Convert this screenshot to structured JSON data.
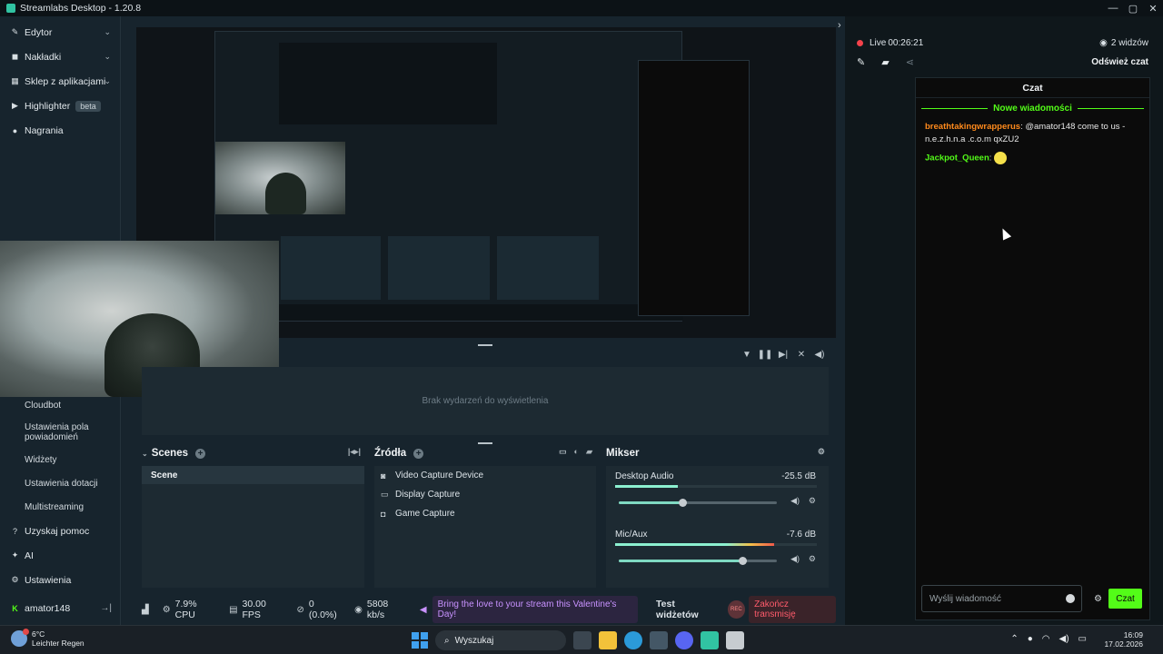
{
  "titlebar": {
    "title": "Streamlabs Desktop - 1.20.8",
    "controls": [
      "—",
      "▢",
      "✕"
    ]
  },
  "sidebar": {
    "items": [
      {
        "label": "Edytor",
        "icon": "pencil-icon",
        "chevron": "⌄"
      },
      {
        "label": "Nakładki",
        "icon": "overlay-icon",
        "chevron": "⌄"
      },
      {
        "label": "Sklep z aplikacjami",
        "icon": "store-icon",
        "chevron": "⌄"
      },
      {
        "label": "Highlighter",
        "icon": "highlighter-icon",
        "badge": "beta"
      },
      {
        "label": "Nagrania",
        "icon": "record-icon"
      }
    ],
    "subitems": [
      "Cloudbot",
      "Ustawienia pola powiadomień",
      "Widżety",
      "Ustawienia dotacji",
      "Multistreaming"
    ],
    "bottom": [
      {
        "label": "Uzyskaj pomoc",
        "icon": "help-icon"
      },
      {
        "label": "AI",
        "icon": "ai-icon"
      },
      {
        "label": "Ustawienia",
        "icon": "gear-icon"
      }
    ],
    "user": {
      "name": "amator148",
      "logout": "→|"
    }
  },
  "events": {
    "empty": "Brak wydarzeń do wyświetlenia"
  },
  "scenes": {
    "title": "Scenes",
    "items": [
      "Scene"
    ]
  },
  "sources": {
    "title": "Źródła",
    "items": [
      {
        "label": "Video Capture Device",
        "icon": "camera-icon"
      },
      {
        "label": "Display Capture",
        "icon": "monitor-icon"
      },
      {
        "label": "Game Capture",
        "icon": "gamepad-icon"
      }
    ]
  },
  "mixer": {
    "title": "Mikser",
    "channels": [
      {
        "name": "Desktop Audio",
        "db": "-25.5 dB",
        "volume": 0.4,
        "level": 0.31
      },
      {
        "name": "Mic/Aux",
        "db": "-7.6 dB",
        "volume": 0.78,
        "level": 0.79
      }
    ]
  },
  "status": {
    "cpu": "7.9% CPU",
    "fps": "30.00 FPS",
    "dropped": "0 (0.0%)",
    "bitrate": "5808 kb/s",
    "promo": "Bring the love to your stream this Valentine's Day!",
    "test": "Test widżetów",
    "rec": "REC",
    "end": "Zakończ transmisję"
  },
  "live": {
    "label": "Live",
    "time": "00:26:21",
    "viewers": "2 widzów",
    "refresh": "Odśwież czat"
  },
  "chat": {
    "title": "Czat",
    "new_messages": "Nowe wiadomości",
    "messages": [
      {
        "user": "breathtakingwrapperus",
        "text": ": @amator148 come to us - n.e.z.h.n.a .c.o.m qxZU2"
      },
      {
        "user": "Jackpot_Queen",
        "text": ":"
      }
    ],
    "placeholder": "Wyślij wiadomość",
    "send": "Czat"
  },
  "taskbar": {
    "temp": "6°C",
    "weather": "Leichter Regen",
    "search": "Wyszukaj",
    "time": "16:09",
    "date": "17.02.2026"
  },
  "colors": {
    "accent": "#31c3a2",
    "kick_green": "#53fc18",
    "live_red": "#f5424b",
    "promo": "#c892ff"
  }
}
